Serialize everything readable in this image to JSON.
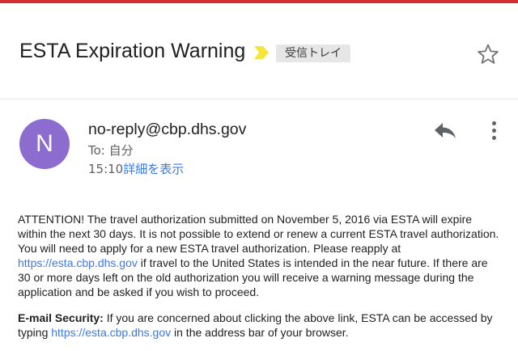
{
  "colors": {
    "top_strip": "#d32f2f",
    "avatar_bg": "#8d6ccf",
    "link": "#3b78e7",
    "importance_marker": "#f7e43b"
  },
  "email": {
    "subject": "ESTA Expiration Warning",
    "label": "受信トレイ",
    "importance_icon": "importance-marker-icon",
    "star_icon": "star-outline-icon"
  },
  "sender": {
    "avatar_letter": "N",
    "address": "no-reply@cbp.dhs.gov",
    "to": "To: 自分",
    "time": "15:10",
    "details_link": "詳細を表示",
    "reply_icon": "reply-icon",
    "more_icon": "more-vert-icon"
  },
  "body": {
    "p1_text_a": "ATTENTION! The travel authorization submitted on November 5, 2016 via ESTA will expire within the next 30 days. It is not possible to extend or renew a current ESTA travel authorization. You will need to apply for a new ESTA travel authorization. Please reapply at ",
    "p1_link": "https://esta.cbp.dhs.gov",
    "p1_text_b": " if travel to the United States is intended in the near future. If there are 30 or more days left on the old authorization you will receive a warning message during the application and be asked if you wish to proceed.",
    "p2_label": "E-mail Security:",
    "p2_text_a": " If you are concerned about clicking the above link, ESTA can be accessed by typing ",
    "p2_link": "https://esta.cbp.dhs.gov",
    "p2_text_b": " in the address bar of your browser."
  }
}
